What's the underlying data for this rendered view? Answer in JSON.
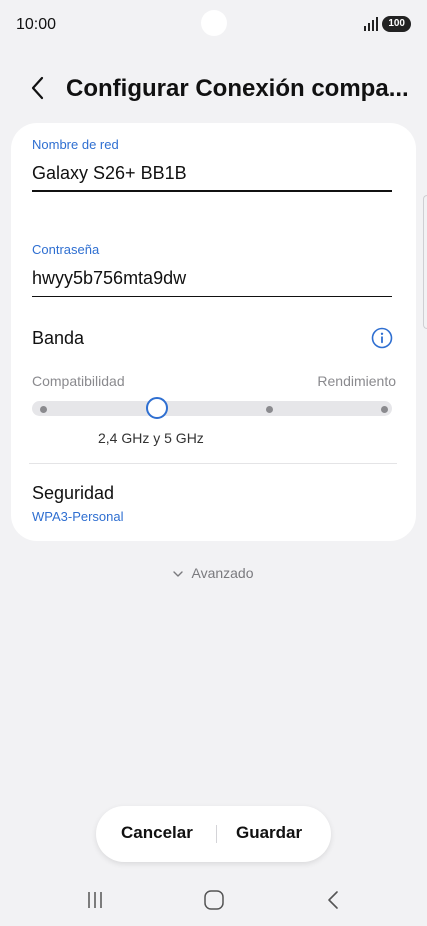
{
  "status_bar": {
    "time": "10:00",
    "battery": "100",
    "signal_icon": "signal-icon"
  },
  "header": {
    "title": "Configurar Conexión compa...",
    "back_icon": "back-chevron-icon"
  },
  "form": {
    "network_name": {
      "label": "Nombre de red",
      "value": "Galaxy S26+ BB1B"
    },
    "password": {
      "label": "Contraseña",
      "value": "hwyy5b756mta9dw"
    },
    "band": {
      "label": "Banda",
      "info_icon": "info-icon",
      "left_label": "Compatibilidad",
      "right_label": "Rendimiento",
      "selected_step": 2,
      "step_count": 5,
      "value": "2,4 GHz y 5 GHz"
    },
    "security": {
      "label": "Seguridad",
      "value": "WPA3-Personal"
    }
  },
  "advanced": {
    "label": "Avanzado",
    "icon": "chevron-down-icon"
  },
  "actions": {
    "cancel": "Cancelar",
    "save": "Guardar"
  },
  "nav": {
    "recents_icon": "recents-icon",
    "home_icon": "home-icon",
    "back_icon": "back-icon"
  },
  "colors": {
    "accent": "#2f6fd1",
    "background": "#f2f2f4",
    "card": "#ffffff"
  }
}
